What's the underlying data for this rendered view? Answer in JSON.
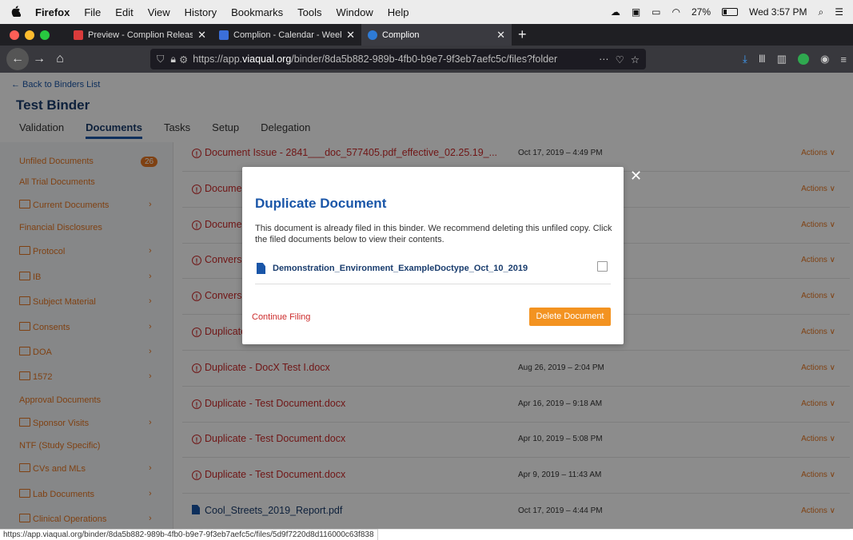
{
  "menubar": {
    "apple": "",
    "items": [
      "Firefox",
      "File",
      "Edit",
      "View",
      "History",
      "Bookmarks",
      "Tools",
      "Window",
      "Help"
    ],
    "battery": "27%",
    "clock": "Wed 3:57 PM"
  },
  "tabs": [
    {
      "title": "Preview - Complion Release No",
      "color": "#d93b3b"
    },
    {
      "title": "Complion - Calendar - Week of",
      "color": "#3b6fd9"
    },
    {
      "title": "Complion",
      "color": "#2e7bd6"
    }
  ],
  "address": {
    "prefix": "https://app.",
    "domain": "viaqual.org",
    "suffix": "/binder/8da5b882-989b-4fb0-b9e7-9f3eb7aefc5c/files?folder",
    "more": "···"
  },
  "app": {
    "back_link": "← Back to Binders List",
    "binder_title": "Test Binder",
    "tabs": [
      "Validation",
      "Documents",
      "Tasks",
      "Setup",
      "Delegation"
    ],
    "active_tab": "Documents"
  },
  "sidebar": {
    "unfiled_label": "Unfiled Documents",
    "unfiled_count": "26",
    "items": [
      {
        "label": "All Trial Documents",
        "folder": false,
        "chev": false
      },
      {
        "label": "Current Documents",
        "folder": true,
        "chev": true
      },
      {
        "label": "Financial Disclosures",
        "folder": false,
        "chev": false
      },
      {
        "label": "Protocol",
        "folder": true,
        "chev": true
      },
      {
        "label": "IB",
        "folder": true,
        "chev": true
      },
      {
        "label": "Subject Material",
        "folder": true,
        "chev": true
      },
      {
        "label": "Consents",
        "folder": true,
        "chev": true
      },
      {
        "label": "DOA",
        "folder": true,
        "chev": true
      },
      {
        "label": "1572",
        "folder": true,
        "chev": true
      },
      {
        "label": "Approval Documents",
        "folder": false,
        "chev": false
      },
      {
        "label": "Sponsor Visits",
        "folder": true,
        "chev": true
      },
      {
        "label": "NTF (Study Specific)",
        "folder": false,
        "chev": false
      },
      {
        "label": "CVs and MLs",
        "folder": true,
        "chev": true
      },
      {
        "label": "Lab Documents",
        "folder": true,
        "chev": true
      },
      {
        "label": "Clinical Operations",
        "folder": true,
        "chev": true
      }
    ]
  },
  "documents": [
    {
      "name": "Document Issue - 2841___doc_577405.pdf_effective_02.25.19_...",
      "date": "Oct 17, 2019 – 4:49 PM",
      "actions": "Actions ∨",
      "warn": true
    },
    {
      "name": "Document",
      "date": "",
      "actions": "Actions ∨",
      "warn": true
    },
    {
      "name": "Document",
      "date": "",
      "actions": "Actions ∨",
      "warn": true
    },
    {
      "name": "Conversion",
      "date": "",
      "actions": "Actions ∨",
      "warn": true
    },
    {
      "name": "Conversion",
      "date": "",
      "actions": "Actions ∨",
      "warn": true
    },
    {
      "name": "Duplicate",
      "date": "",
      "actions": "Actions ∨",
      "warn": true
    },
    {
      "name": "Duplicate - DocX Test I.docx",
      "date": "Aug 26, 2019 – 2:04 PM",
      "actions": "Actions ∨",
      "warn": true
    },
    {
      "name": "Duplicate - Test Document.docx",
      "date": "Apr 16, 2019 – 9:18 AM",
      "actions": "Actions ∨",
      "warn": true
    },
    {
      "name": "Duplicate - Test Document.docx",
      "date": "Apr 10, 2019 – 5:08 PM",
      "actions": "Actions ∨",
      "warn": true
    },
    {
      "name": "Duplicate - Test Document.docx",
      "date": "Apr 9, 2019 – 11:43 AM",
      "actions": "Actions ∨",
      "warn": true
    },
    {
      "name": "Cool_Streets_2019_Report.pdf",
      "date": "Oct 17, 2019 – 4:44 PM",
      "actions": "Actions ∨",
      "warn": false
    }
  ],
  "modal": {
    "title": "Duplicate Document",
    "message": "This document is already filed in this binder. We recommend deleting this unfiled copy. Click the filed documents below to view their contents.",
    "file_name": "Demonstration_Environment_ExampleDoctype_Oct_10_2019",
    "continue_label": "Continue Filing",
    "delete_label": "Delete Document",
    "close_glyph": "✕"
  },
  "status_url": "https://app.viaqual.org/binder/8da5b882-989b-4fb0-b9e7-9f3eb7aefc5c/files/5d9f7220d8d116000c63f838"
}
